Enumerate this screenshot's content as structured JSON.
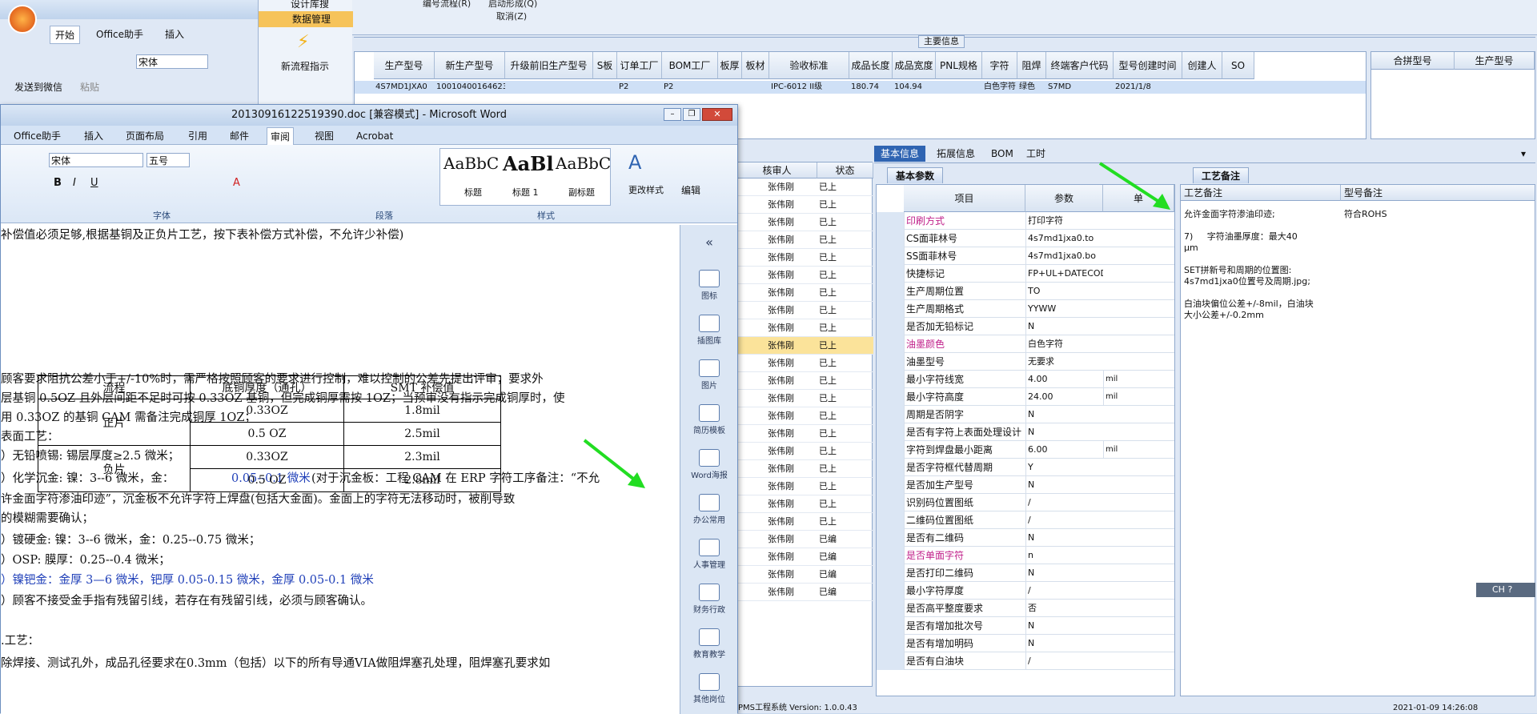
{
  "erp": {
    "ribbon_labels": [
      "编号流程(R)",
      "启动形成(Q)",
      "取消(Z)"
    ],
    "section_title": "主要信息",
    "main_headers": [
      "生产型号",
      "新生产型号",
      "升级前旧生产型号",
      "S板",
      "订单工厂",
      "BOM工厂",
      "板厚",
      "板材",
      "验收标准",
      "成品长度",
      "成品宽度",
      "PNL规格",
      "字符",
      "阻焊",
      "终端客户代码",
      "型号创建时间",
      "创建人",
      "SO"
    ],
    "main_row": [
      "4S7MD1JXA0",
      "10010400164623",
      "",
      "",
      "P2",
      "P2",
      "",
      "",
      "IPC-6012 II级",
      "180.74",
      "104.94",
      "",
      "白色字符",
      "绿色",
      "S7MD",
      "2021/1/8",
      "",
      ""
    ],
    "side_headers": [
      "合拼型号",
      "生产型号"
    ],
    "mid_headers": [
      "核审人",
      "状态"
    ],
    "mid_rows": [
      [
        "张伟刚",
        "已上"
      ],
      [
        "张伟刚",
        "已上"
      ],
      [
        "张伟刚",
        "已上"
      ],
      [
        "张伟刚",
        "已上"
      ],
      [
        "张伟刚",
        "已上"
      ],
      [
        "张伟刚",
        "已上"
      ],
      [
        "张伟刚",
        "已上"
      ],
      [
        "张伟刚",
        "已上"
      ],
      [
        "张伟刚",
        "已上"
      ],
      [
        "张伟刚",
        "已上"
      ],
      [
        "张伟刚",
        "已上"
      ],
      [
        "张伟刚",
        "已上"
      ],
      [
        "张伟刚",
        "已上"
      ],
      [
        "张伟刚",
        "已上"
      ],
      [
        "张伟刚",
        "已上"
      ],
      [
        "张伟刚",
        "已上"
      ],
      [
        "张伟刚",
        "已上"
      ],
      [
        "张伟刚",
        "已上"
      ],
      [
        "张伟刚",
        "已上"
      ],
      [
        "张伟刚",
        "已上"
      ],
      [
        "张伟刚",
        "已编"
      ],
      [
        "张伟刚",
        "已编"
      ],
      [
        "张伟刚",
        "已编"
      ],
      [
        "张伟刚",
        "已编"
      ]
    ],
    "tabs": [
      "基本信息",
      "拓展信息",
      "BOM",
      "工时"
    ],
    "params_title": "基本参数",
    "params_headers": [
      "项目",
      "参数",
      "单"
    ],
    "params": [
      [
        "印刷方式",
        "打印字符",
        ""
      ],
      [
        "CS面菲林号",
        "4s7md1jxa0.to",
        ""
      ],
      [
        "SS面菲林号",
        "4s7md1jxa0.bo",
        ""
      ],
      [
        "快捷标记",
        "FP+UL+DATECODE",
        ""
      ],
      [
        "生产周期位置",
        "TO",
        ""
      ],
      [
        "生产周期格式",
        "YYWW",
        ""
      ],
      [
        "是否加无铅标记",
        "N",
        ""
      ],
      [
        "油墨颜色",
        "白色字符",
        ""
      ],
      [
        "油墨型号",
        "无要求",
        ""
      ],
      [
        "最小字符线宽",
        "4.00",
        "mil"
      ],
      [
        "最小字符高度",
        "24.00",
        "mil"
      ],
      [
        "周期是否阴字",
        "N",
        ""
      ],
      [
        "是否有字符上表面处理设计",
        "N",
        ""
      ],
      [
        "字符到焊盘最小距离",
        "6.00",
        "mil"
      ],
      [
        "是否字符框代替周期",
        "Y",
        ""
      ],
      [
        "是否加生产型号",
        "N",
        ""
      ],
      [
        "识别码位置图纸",
        "/",
        ""
      ],
      [
        "二维码位置图纸",
        "/",
        ""
      ],
      [
        "是否有二维码",
        "N",
        ""
      ],
      [
        "是否单面字符",
        "n",
        ""
      ],
      [
        "是否打印二维码",
        "N",
        ""
      ],
      [
        "最小字符厚度",
        "/",
        ""
      ],
      [
        "是否高平整度要求",
        "否",
        ""
      ],
      [
        "是否有增加批次号",
        "N",
        ""
      ],
      [
        "是否有增加明码",
        "N",
        ""
      ],
      [
        "是否有白油块",
        "/",
        ""
      ]
    ],
    "remarks_title": "工艺备注",
    "remarks_headers": [
      "工艺备注",
      "型号备注"
    ],
    "remark_text": "允许金面字符渗油印迹;\n\n7)     字符油墨厚度：最大40\nμm\n\nSET拼新号和周期的位置图:\n4s7md1jxa0位置号及周期.jpg;\n\n白油块偏位公差+/-8mil，白油块\n大小公差+/-0.2mm",
    "model_remark": "符合ROHS",
    "status": "PMS工程系统 Version: 1.0.0.43",
    "time": "2021-01-09 14:26:08"
  },
  "excel": {
    "tabs": [
      "开始",
      "Office助手",
      "插入"
    ],
    "font": "宋体",
    "labels": [
      "发送到微信",
      "粘贴"
    ],
    "menu": [
      "设计库搜",
      "数据管理",
      "新流程指示"
    ]
  },
  "word": {
    "title": "20130916122519390.doc [兼容模式] - Microsoft Word",
    "tabs": [
      "Office助手",
      "插入",
      "页面布局",
      "引用",
      "邮件",
      "审阅",
      "视图",
      "Acrobat"
    ],
    "font": "宋体",
    "size": "五号",
    "styles": [
      "标题",
      "标题 1",
      "副标题"
    ],
    "style_samples": [
      "AaBbC",
      "AaBl",
      "AaBbC"
    ],
    "groups": [
      "字体",
      "段落",
      "样式",
      "编辑"
    ],
    "change_style": "更改样式",
    "edit": "编辑",
    "doc_lines": [
      "补偿值必须足够,根据基铜及正负片工艺，按下表补偿方式补偿，不允许少补偿)",
      "顾客要求阻抗公差小于+/-10%时，需严格按照顾客的要求进行控制，难以控制的公差先提出评审；要求外",
      "层基铜 0.5OZ 且外层间距不足时可按 0.33OZ 基铜，但完成铜厚需按 1OZ；当预审没有指示完成铜厚时，使",
      "用 0.33OZ 的基铜 CAM 需备注完成铜厚 1OZ；",
      "表面工艺：",
      "）无铅喷锡:   锡层厚度≥2.5 微米；",
      "）化学沉金:   镍：3--6 微米，金：",
      "0.05--0.1 微米",
      "(对于沉金板：工程 CAM 在 ERP 字符工序备注：“不允",
      "  许金面字符渗油印迹”，沉金板不允许字符上焊盘(包括大金面)。金面上的字符无法移动时，被削导致",
      "  的模糊需要确认；",
      "）镀硬金:        镍：3--6 微米，金：0.25--0.75 微米；",
      "）OSP:          膜厚：0.25--0.4 微米；",
      "）镍钯金：金厚 3—6 微米，钯厚 0.05-0.15 微米，金厚 0.05-0.1 微米",
      "）顾客不接受金手指有残留引线，若存在有残留引线，必须与顾客确认。",
      ".工艺：",
      "除焊接、测试孔外，成品孔径要求在0.3mm（包括）以下的所有导通VIA做阻焊塞孔处理，阻焊塞孔要求如"
    ],
    "table": {
      "headers": [
        "流程",
        "底铜厚度（通孔）",
        "SMT 补偿值"
      ],
      "rows": [
        [
          "正片",
          "0.33OZ",
          "1.8mil"
        ],
        [
          "",
          "0.5 OZ",
          "2.5mil"
        ],
        [
          "负片",
          "0.33OZ",
          "2.3mil"
        ],
        [
          "",
          "0.5 OZ",
          "2.8mil"
        ]
      ]
    },
    "side_items": [
      "图标",
      "插图库",
      "图片",
      "简历模板",
      "Word海报",
      "办公常用",
      "人事管理",
      "财务行政",
      "教育教学",
      "其他岗位"
    ]
  }
}
